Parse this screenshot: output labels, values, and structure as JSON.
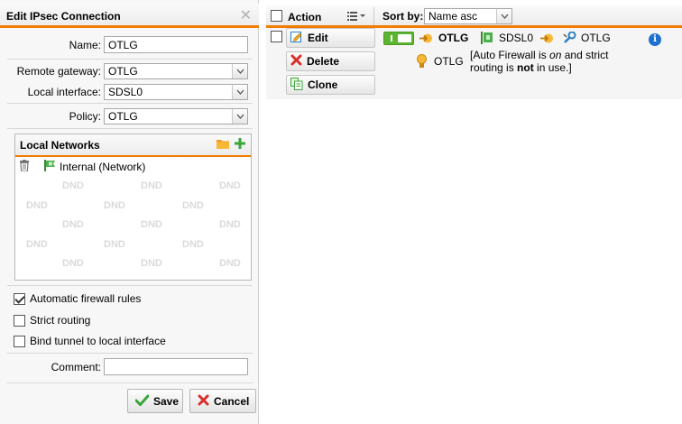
{
  "panel": {
    "title": "Edit IPsec Connection",
    "close_glyph": "✕",
    "name_label": "Name:",
    "name_value": "OTLG",
    "remote_gateway_label": "Remote gateway:",
    "remote_gateway_value": "OTLG",
    "local_interface_label": "Local interface:",
    "local_interface_value": "SDSL0",
    "policy_label": "Policy:",
    "policy_value": "OTLG",
    "local_networks": {
      "title": "Local Networks",
      "item_label": "Internal (Network)",
      "dnd_text": "DND"
    },
    "auto_firewall_label": "Automatic firewall rules",
    "auto_firewall_checked": true,
    "strict_routing_label": "Strict routing",
    "strict_routing_checked": false,
    "bind_tunnel_label": "Bind tunnel to local interface",
    "bind_tunnel_checked": false,
    "comment_label": "Comment:",
    "comment_value": "",
    "save_label": "Save",
    "cancel_label": "Cancel"
  },
  "list": {
    "action_header": "Action",
    "sort_by_label": "Sort by:",
    "sort_by_value": "Name asc",
    "edit_label": "Edit",
    "delete_label": "Delete",
    "clone_label": "Clone",
    "entry": {
      "enabled": true,
      "name": "OTLG",
      "interface": "SDSL0",
      "remote": "OTLG",
      "policy": "OTLG",
      "note_pre": "[Auto Firewall is ",
      "note_on": "on",
      "note_mid": " and strict",
      "note_line2_pre": "routing is ",
      "note_not": "not",
      "note_line2_post": " in use.]"
    }
  },
  "colors": {
    "accent": "#f07c00",
    "toggle_on": "#5cb531",
    "info": "#1f6fd1",
    "cancel_x": "#d9302c",
    "save_check": "#3aa53a"
  },
  "icons": [
    "close-icon",
    "chevron-down-icon",
    "folder-icon",
    "plus-icon",
    "trash-icon",
    "network-flag-icon",
    "checkbox-icon",
    "save-check-icon",
    "cancel-x-icon",
    "list-menu-icon",
    "edit-icon",
    "delete-x-icon",
    "clone-icon",
    "toggle-icon",
    "arrow-in-icon",
    "interface-icon",
    "gateway-icon",
    "policy-icon",
    "info-icon"
  ]
}
